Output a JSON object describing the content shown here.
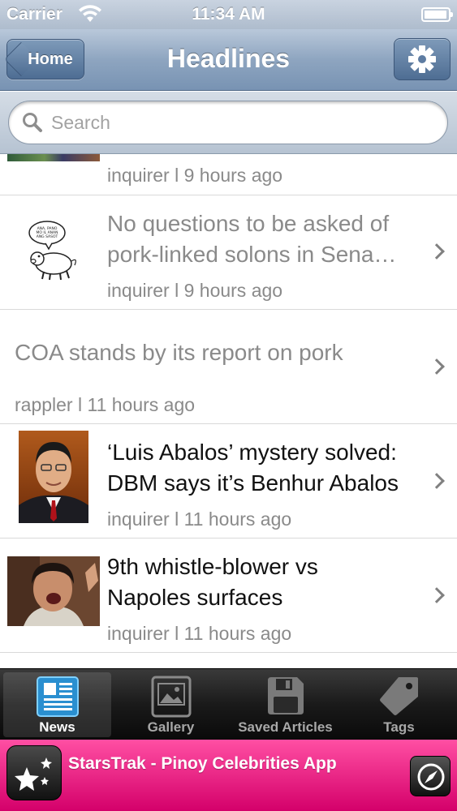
{
  "status_bar": {
    "carrier": "Carrier",
    "time": "11:34 AM"
  },
  "nav_bar": {
    "back_label": "Home",
    "title": "Headlines"
  },
  "search": {
    "placeholder": "Search"
  },
  "articles": [
    {
      "title": "",
      "meta": "inquirer l 9 hours ago"
    },
    {
      "title": "No questions to be asked of pork-linked solons in Sena…",
      "meta": "inquirer l 9 hours ago"
    },
    {
      "title": "COA stands by its report on pork",
      "meta": "rappler l 11 hours ago"
    },
    {
      "title": "‘Luis Abalos’ mystery solved: DBM says it’s Benhur Abalos",
      "meta": "inquirer l 11 hours ago"
    },
    {
      "title": "9th whistle-blower vs Napoles surfaces",
      "meta": "inquirer l 11 hours ago"
    }
  ],
  "cartoon_speech": "ANA, PANO MO IL ANAN ANG SASOT NYEN? NGIT IYO ARDELIO?",
  "tabs": [
    {
      "label": "News",
      "icon": "newspaper-icon",
      "active": true
    },
    {
      "label": "Gallery",
      "icon": "picture-icon",
      "active": false
    },
    {
      "label": "Saved Articles",
      "icon": "floppy-disk-icon",
      "active": false
    },
    {
      "label": "Tags",
      "icon": "tag-icon",
      "active": false
    }
  ],
  "ad": {
    "text": "StarsTrak - Pinoy Celebrities App",
    "icon": "stars-icon",
    "action_icon": "compass-icon"
  },
  "colors": {
    "nav_blue": "#7893b3",
    "read_gray": "#8a8a8a",
    "ad_pink": "#e8007d",
    "tab_active": "#3ea9e6"
  }
}
